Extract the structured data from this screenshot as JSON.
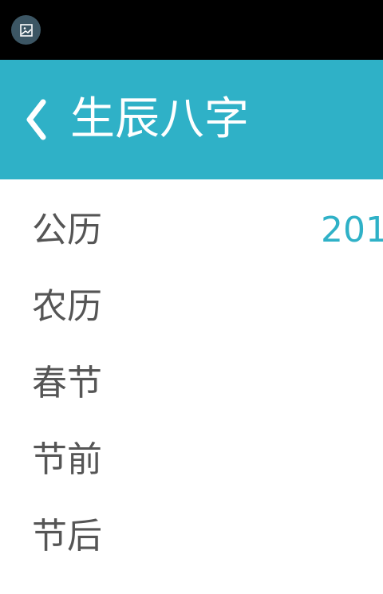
{
  "status_bar": {
    "icon": "image-icon"
  },
  "header": {
    "back_icon": "chevron-left-icon",
    "title": "生辰八字",
    "background_color": "#2fb1c7"
  },
  "rows": [
    {
      "label": "公历",
      "value": "201"
    },
    {
      "label": "农历",
      "value": ""
    },
    {
      "label": "春节",
      "value": ""
    },
    {
      "label": "节前",
      "value": ""
    },
    {
      "label": "节后",
      "value": ""
    }
  ],
  "colors": {
    "accent": "#2fb1c7",
    "label_text": "#555555"
  }
}
